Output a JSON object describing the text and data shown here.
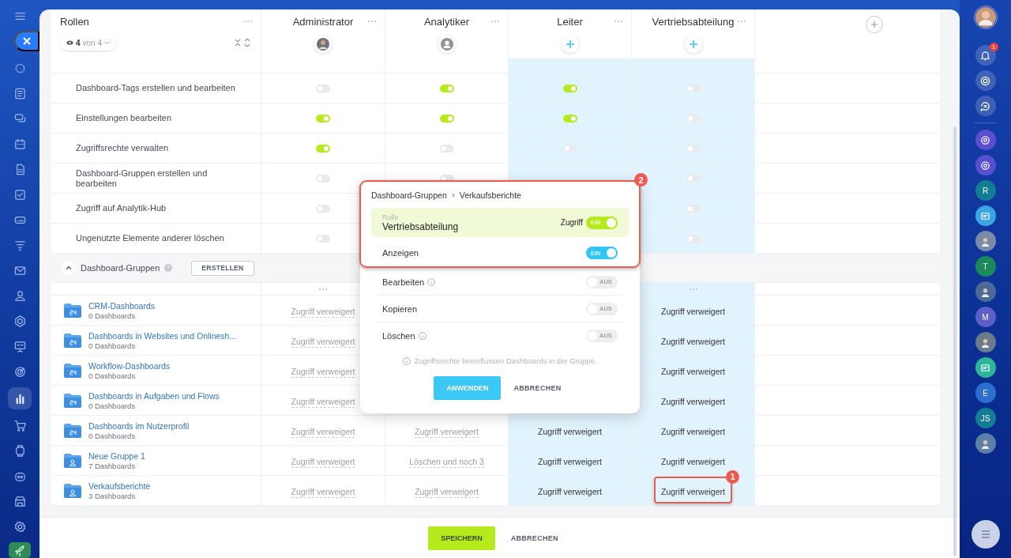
{
  "left_nav": [
    {
      "kind": "feed",
      "selected": false
    },
    {
      "kind": "news",
      "selected": false
    },
    {
      "kind": "chat",
      "selected": false
    },
    {
      "kind": "calendar",
      "selected": false
    },
    {
      "kind": "doc",
      "selected": false
    },
    {
      "kind": "task",
      "selected": false
    },
    {
      "kind": "drive",
      "selected": false
    },
    {
      "kind": "funnel",
      "selected": false
    },
    {
      "kind": "mail",
      "selected": false
    },
    {
      "kind": "people",
      "selected": false
    },
    {
      "kind": "hexagon",
      "selected": false
    },
    {
      "kind": "board",
      "selected": false
    },
    {
      "kind": "target",
      "selected": false
    },
    {
      "kind": "chart",
      "selected": true
    },
    {
      "kind": "cart",
      "selected": false
    },
    {
      "kind": "watch",
      "selected": false
    },
    {
      "kind": "robot",
      "selected": false
    },
    {
      "kind": "store",
      "selected": false
    },
    {
      "kind": "gear",
      "selected": false
    },
    {
      "kind": "rocket",
      "selected": false
    }
  ],
  "roles_header": {
    "title": "Rollen",
    "filter_count": "4",
    "filter_total": "von 4"
  },
  "columns": [
    {
      "name": "Administrator",
      "assignee": {
        "kind": "photo"
      },
      "selected": false
    },
    {
      "name": "Analytiker",
      "assignee": {
        "kind": "user"
      },
      "selected": false
    },
    {
      "name": "Leiter",
      "assignee": {
        "kind": "add"
      },
      "selected": true
    },
    {
      "name": "Vertriebsabteilung",
      "assignee": {
        "kind": "add"
      },
      "selected": true
    }
  ],
  "permissions": [
    {
      "label": "Dashboard-Tags erstellen und bearbeiten",
      "values": [
        {
          "kind": "toggle",
          "on": false
        },
        {
          "kind": "toggle",
          "on": true
        },
        {
          "kind": "toggle",
          "on": true
        },
        {
          "kind": "toggle",
          "on": false
        }
      ]
    },
    {
      "label": "Einstellungen bearbeiten",
      "values": [
        {
          "kind": "toggle",
          "on": true
        },
        {
          "kind": "toggle",
          "on": true
        },
        {
          "kind": "toggle",
          "on": true
        },
        {
          "kind": "toggle",
          "on": false
        }
      ]
    },
    {
      "label": "Zugriffsrechte verwalten",
      "values": [
        {
          "kind": "toggle",
          "on": true
        },
        {
          "kind": "toggle",
          "on": false
        },
        {
          "kind": "toggle",
          "on": false
        },
        {
          "kind": "toggle",
          "on": false
        }
      ]
    },
    {
      "label": "Dashboard-Gruppen erstellen und bearbeiten",
      "values": [
        {
          "kind": "toggle",
          "on": false
        },
        {
          "kind": "toggle",
          "on": false
        },
        {
          "kind": "covered"
        },
        {
          "kind": "toggle",
          "on": false
        }
      ]
    },
    {
      "label": "Zugriff auf Analytik-Hub",
      "values": [
        {
          "kind": "toggle",
          "on": false
        },
        {
          "kind": "hidden"
        },
        {
          "kind": "hidden"
        },
        {
          "kind": "toggle",
          "on": false
        }
      ]
    },
    {
      "label": "Ungenutzte Elemente anderer löschen",
      "values": [
        {
          "kind": "toggle",
          "on": false
        },
        {
          "kind": "hidden"
        },
        {
          "kind": "hidden"
        },
        {
          "kind": "toggle",
          "on": false
        }
      ]
    }
  ],
  "groups_section": {
    "title": "Dashboard-Gruppen",
    "expanded": true,
    "create_button": "ERSTELLEN"
  },
  "groups": [
    {
      "name": "CRM-Dashboards",
      "count": "0 Dashboards",
      "kind": "system",
      "access": [
        {
          "kind": "link",
          "text": "Zugriff verweigert"
        },
        {
          "kind": "covered"
        },
        {
          "kind": "covered"
        },
        {
          "kind": "link",
          "text": "Zugriff verweigert"
        }
      ]
    },
    {
      "name": "Dashboards in Websites und Onlinesh...",
      "count": "0 Dashboards",
      "kind": "system",
      "access": [
        {
          "kind": "link",
          "text": "Zugriff verweigert"
        },
        {
          "kind": "covered"
        },
        {
          "kind": "covered"
        },
        {
          "kind": "link",
          "text": "Zugriff verweigert"
        }
      ]
    },
    {
      "name": "Workflow-Dashboards",
      "count": "0 Dashboards",
      "kind": "system",
      "access": [
        {
          "kind": "link",
          "text": "Zugriff verweigert"
        },
        {
          "kind": "covered"
        },
        {
          "kind": "covered"
        },
        {
          "kind": "link",
          "text": "Zugriff verweigert"
        }
      ]
    },
    {
      "name": "Dashboards in Aufgaben und Flows",
      "count": "0 Dashboards",
      "kind": "system",
      "access": [
        {
          "kind": "link",
          "text": "Zugriff verweigert"
        },
        {
          "kind": "covered"
        },
        {
          "kind": "covered"
        },
        {
          "kind": "link",
          "text": "Zugriff verweigert"
        }
      ]
    },
    {
      "name": "Dashboards im Nutzerprofil",
      "count": "0 Dashboards",
      "kind": "system",
      "access": [
        {
          "kind": "link",
          "text": "Zugriff verweigert"
        },
        {
          "kind": "link",
          "text": "Zugriff verweigert"
        },
        {
          "kind": "link",
          "text": "Zugriff verweigert"
        },
        {
          "kind": "link",
          "text": "Zugriff verweigert"
        }
      ]
    },
    {
      "name": "Neue Gruppe 1",
      "count": "7 Dashboards",
      "kind": "user",
      "access": [
        {
          "kind": "link",
          "text": "Zugriff verweigert"
        },
        {
          "kind": "link",
          "text": "Löschen und noch 3"
        },
        {
          "kind": "link",
          "text": "Zugriff verweigert"
        },
        {
          "kind": "link",
          "text": "Zugriff verweigert"
        }
      ]
    },
    {
      "name": "Verkaufsberichte",
      "count": "3 Dashboards",
      "kind": "user",
      "access": [
        {
          "kind": "link",
          "text": "Zugriff verweigert"
        },
        {
          "kind": "link",
          "text": "Zugriff verweigert"
        },
        {
          "kind": "link",
          "text": "Zugriff verweigert"
        },
        {
          "kind": "link",
          "text": "Zugriff verweigert",
          "annotation": "1"
        }
      ]
    }
  ],
  "popup": {
    "annotation": "2",
    "breadcrumb": [
      "Dashboard-Gruppen",
      "Verkaufsberichte"
    ],
    "role_label": "Rolle",
    "role_name": "Vertriebsabteilung",
    "access_label": "Zugriff",
    "access_on": true,
    "access_toggle_text": "EIN",
    "rights": [
      {
        "label": "Anzeigen",
        "info": false,
        "on": true,
        "toggle_text": "EIN"
      },
      {
        "label": "Bearbeiten",
        "info": true,
        "on": false,
        "toggle_text": "AUS"
      },
      {
        "label": "Kopieren",
        "info": false,
        "on": false,
        "toggle_text": "AUS"
      },
      {
        "label": "Löschen",
        "info": true,
        "on": false,
        "toggle_text": "AUS"
      }
    ],
    "note": "Zugriffsrechte beeinflussen Dashboards in der Gruppe.",
    "apply_button": "ANWENDEN",
    "cancel_button": "ABBRECHEN"
  },
  "footer": {
    "save_button": "SPEICHERN",
    "cancel_button": "ABBRECHEN"
  },
  "right_bar": [
    {
      "kind": "bell",
      "badge": "1"
    },
    {
      "kind": "copilot"
    },
    {
      "kind": "sync"
    },
    {
      "kind": "app",
      "color": "#5a4fd0"
    },
    {
      "kind": "app",
      "color": "#5a4fd0"
    },
    {
      "kind": "letter",
      "text": "R",
      "color": "#127d94"
    },
    {
      "kind": "picture",
      "color": "#3aa6e6"
    },
    {
      "kind": "avatar",
      "color": "#7b8aa8"
    },
    {
      "kind": "letter",
      "text": "T",
      "color": "#1a8a5a"
    },
    {
      "kind": "avatar",
      "color": "#4b6a98"
    },
    {
      "kind": "letter",
      "text": "M",
      "color": "#5b5fc7"
    },
    {
      "kind": "avatar",
      "color": "#6c7b8c"
    },
    {
      "kind": "picture",
      "color": "#2bb59a"
    },
    {
      "kind": "letter",
      "text": "E",
      "color": "#2c6fd0"
    },
    {
      "kind": "letter",
      "text": "JS",
      "color": "#127d94"
    },
    {
      "kind": "avatar",
      "color": "#5d7fa8"
    }
  ]
}
